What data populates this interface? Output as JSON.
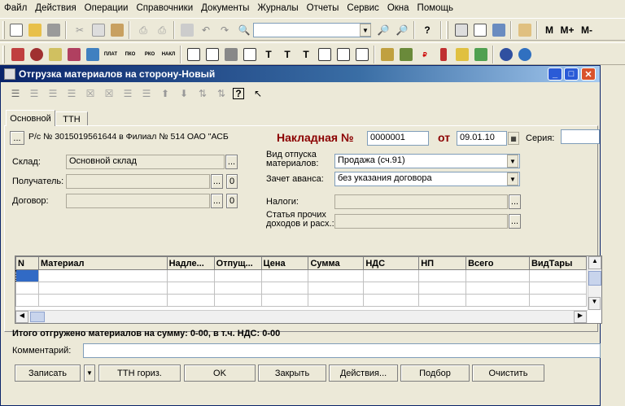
{
  "menu": [
    "Файл",
    "Действия",
    "Операции",
    "Справочники",
    "Документы",
    "Журналы",
    "Отчеты",
    "Сервис",
    "Окна",
    "Помощь"
  ],
  "toolbar": {
    "mplus": "M",
    "mplus2": "M+",
    "mminus": "M-",
    "search_value": ""
  },
  "toolbar2": {
    "plat": "ПЛАТ",
    "pko": "ПКО",
    "rko": "РКО",
    "nakl": "НАКЛ"
  },
  "window": {
    "title": "Отгрузка материалов на сторону-Новый",
    "tabs": [
      "Основной",
      "ТТН"
    ],
    "account": "Р/с № 3015019561644 в Филиал № 514 ОАО \"АСБ",
    "doc_label": "Накладная №",
    "doc_number": "0000001",
    "from_label": "от",
    "doc_date": "09.01.10",
    "series_label": "Серия:",
    "series_value": "",
    "sklad_label": "Склад:",
    "sklad_value": "Основной склад",
    "recipient_label": "Получатель:",
    "recipient_value": "",
    "contract_label": "Договор:",
    "contract_value": "",
    "zero": "0",
    "vid_label": "Вид отпуска материалов:",
    "vid_value": "Продажа (сч.91)",
    "advance_label": "Зачет аванса:",
    "advance_value": "без указания договора",
    "taxes_label": "Налоги:",
    "taxes_value": "",
    "article_label": "Статья прочих доходов и расх.:",
    "article_value": "",
    "columns": [
      "N",
      "Материал",
      "Надле...",
      "Отпущ...",
      "Цена",
      "Сумма",
      "НДС",
      "НП",
      "Всего",
      "ВидТары"
    ],
    "total_text": "Итого отгружено материалов на сумму: 0-00, в т.ч. НДС: 0-00",
    "comment_label": "Комментарий:",
    "comment_value": "",
    "buttons": {
      "save": "Записать",
      "ttn": "ТТН гориз.",
      "ok": "OK",
      "close": "Закрыть",
      "actions": "Действия...",
      "select": "Подбор",
      "clear": "Очистить"
    }
  }
}
